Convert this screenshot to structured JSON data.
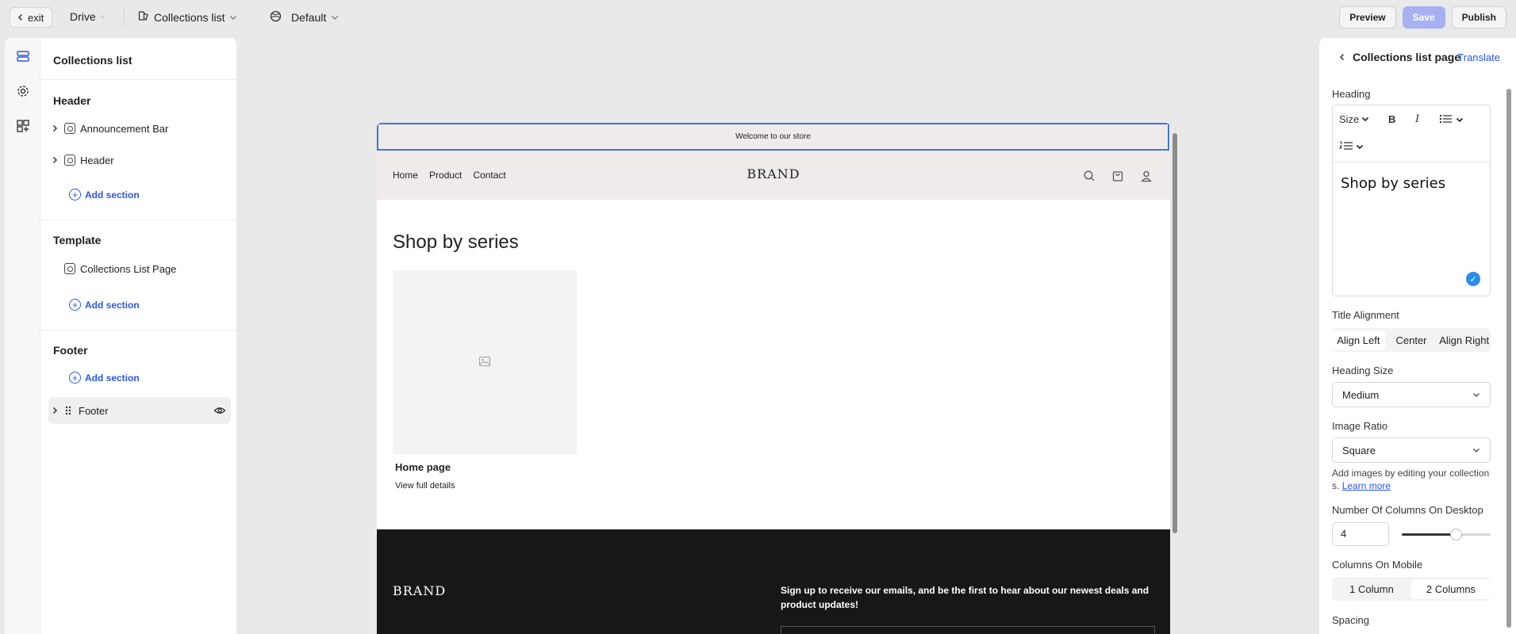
{
  "topbar": {
    "exit_label": "exit",
    "store_name": "Drive",
    "page_label": "Collections list",
    "theme_label": "Default",
    "preview_label": "Preview",
    "save_label": "Save",
    "publish_label": "Publish"
  },
  "left_panel": {
    "title": "Collections list",
    "groups": [
      {
        "name": "Header",
        "items": [
          "Announcement Bar",
          "Header"
        ],
        "add_label": "Add section"
      },
      {
        "name": "Template",
        "items": [
          "Collections List Page"
        ],
        "add_label": "Add section"
      },
      {
        "name": "Footer",
        "items": [
          "Footer"
        ],
        "add_label": "Add section"
      }
    ]
  },
  "preview": {
    "announcement": "Welcome to our store",
    "nav_links": [
      "Home",
      "Product",
      "Contact"
    ],
    "brand": "BRAND",
    "heading": "Shop by series",
    "card": {
      "title": "Home page",
      "link": "View full details"
    },
    "footer": {
      "brand": "BRAND",
      "signup_text": "Sign up to receive our emails, and be the first to hear about our newest deals and product updates!"
    }
  },
  "right_panel": {
    "title": "Collections list page",
    "translate_label": "Translate",
    "heading_label": "Heading",
    "rte": {
      "size_label": "Size",
      "bold": "B",
      "italic": "I",
      "text": "Shop by series"
    },
    "title_alignment_label": "Title Alignment",
    "alignment_options": [
      "Align Left",
      "Center",
      "Align Right"
    ],
    "alignment_selected": "Align Left",
    "heading_size_label": "Heading Size",
    "heading_size_value": "Medium",
    "image_ratio_label": "Image Ratio",
    "image_ratio_value": "Square",
    "help_text": "Add images by editing your collection s.",
    "learn_more": "Learn more",
    "columns_desktop_label": "Number Of Columns On Desktop",
    "columns_desktop_value": "4",
    "columns_desktop_fraction": 0.6,
    "columns_mobile_label": "Columns On Mobile",
    "mobile_options": [
      "1 Column",
      "2 Columns"
    ],
    "mobile_selected": "2 Columns",
    "spacing_label": "Spacing"
  },
  "colors": {
    "accent": "#2a57e8",
    "selection_border": "#3d73e0",
    "save_disabled": "#a7b1f1"
  }
}
